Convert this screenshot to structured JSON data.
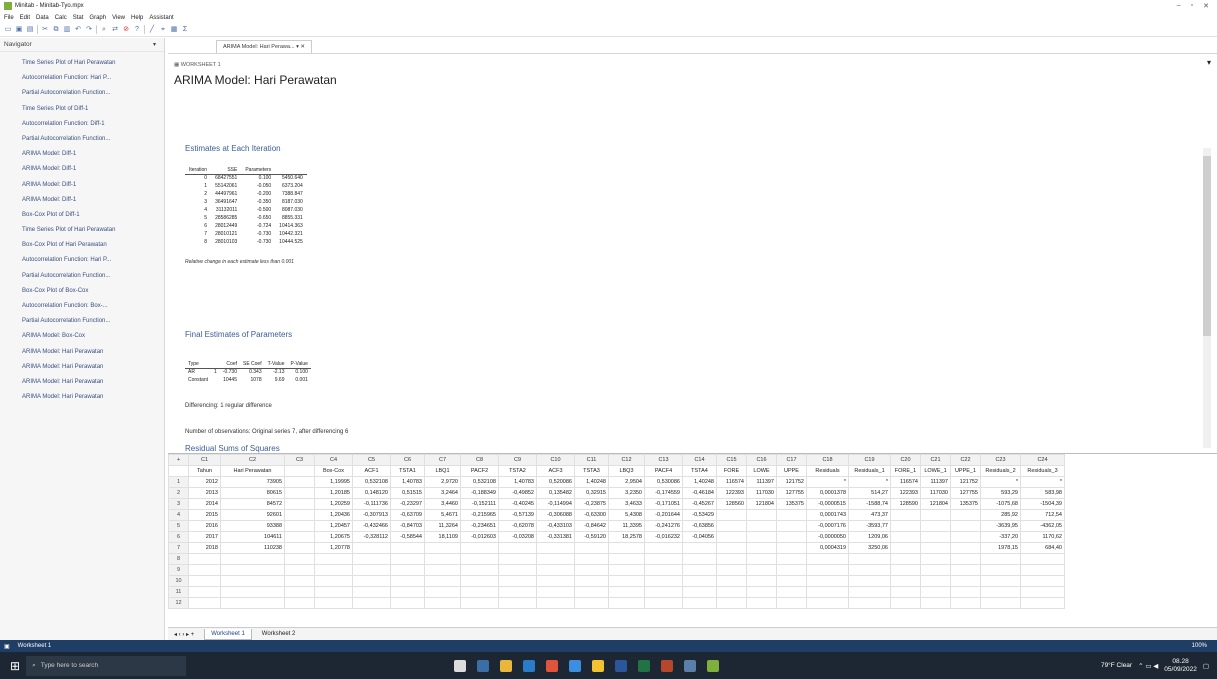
{
  "window": {
    "title": "Minitab - Minitab-Tyo.mpx"
  },
  "menu": [
    "File",
    "Edit",
    "Data",
    "Calc",
    "Stat",
    "Graph",
    "View",
    "Help",
    "Assistant"
  ],
  "navigator": {
    "title": "Navigator",
    "items": [
      "Time Series Plot of Hari Perawatan",
      "Autocorrelation Function: Hari P...",
      "Partial Autocorrelation Function...",
      "Time Series Plot of Diff-1",
      "Autocorrelation Function: Diff-1",
      "Partial Autocorrelation Function...",
      "ARIMA Model: Diff-1",
      "ARIMA Model: Diff-1",
      "ARIMA Model: Diff-1",
      "ARIMA Model: Diff-1",
      "Box-Cox Plot of Diff-1",
      "Time Series Plot of Hari Perawatan",
      "Box-Cox Plot of Hari Perawatan",
      "Autocorrelation Function: Hari P...",
      "Partial Autocorrelation Function...",
      "Box-Cox Plot of Box-Cox",
      "Autocorrelation Function: Box-...",
      "Partial Autocorrelation Function...",
      "ARIMA Model: Box-Cox",
      "ARIMA Model: Hari Perawatan",
      "ARIMA Model: Hari Perawatan",
      "ARIMA Model: Hari Perawatan",
      "ARIMA Model: Hari Perawatan"
    ]
  },
  "output": {
    "tab_label": "ARIMA Model: Hari Perawa...",
    "worksheet": "WORKSHEET 1",
    "title": "ARIMA Model: Hari Perawatan",
    "estimates_heading": "Estimates at Each Iteration",
    "iter_headers": [
      "Iteration",
      "SSE",
      "Parameters",
      ""
    ],
    "iterations": [
      [
        "0",
        "68427551",
        "0.100",
        "5450.640"
      ],
      [
        "1",
        "55142061",
        "-0.050",
        "6373.204"
      ],
      [
        "2",
        "44497961",
        "-0.200",
        "7388.847"
      ],
      [
        "3",
        "36491647",
        "-0.350",
        "8187.030"
      ],
      [
        "4",
        "31132011",
        "-0.500",
        "8087.030"
      ],
      [
        "5",
        "28586285",
        "-0.650",
        "8855.331"
      ],
      [
        "6",
        "28012449",
        "-0.724",
        "10414.363"
      ],
      [
        "7",
        "28010121",
        "-0.730",
        "10442.321"
      ],
      [
        "8",
        "28010103",
        "-0.730",
        "10444.525"
      ]
    ],
    "conv_note": "Relative change in each estimate less than 0.001",
    "final_heading": "Final Estimates of Parameters",
    "param_headers": [
      "Type",
      "",
      "Coef",
      "SE Coef",
      "T-Value",
      "P-Value"
    ],
    "params": [
      [
        "AR",
        "1",
        "-0.730",
        "0.343",
        "-2.13",
        "0.100"
      ],
      [
        "Constant",
        "",
        "10445",
        "1078",
        "9.69",
        "0.001"
      ]
    ],
    "differencing": "Differencing: 1 regular difference",
    "observations": "Number of observations:  Original series 7, after differencing 6",
    "rss_heading": "Residual Sums of Squares"
  },
  "sheet": {
    "cols": [
      "C1",
      "C2",
      "C3",
      "C4",
      "C5",
      "C6",
      "C7",
      "C8",
      "C9",
      "C10",
      "C11",
      "C12",
      "C13",
      "C14",
      "C15",
      "C16",
      "C17",
      "C18",
      "C19",
      "C20",
      "C21",
      "C22",
      "C23",
      "C24"
    ],
    "names": [
      "Tahun",
      "Hari Perawatan",
      "",
      "Box-Cox",
      "ACF1",
      "TSTA1",
      "LBQ1",
      "PACF2",
      "TSTA2",
      "ACF3",
      "TSTA3",
      "LBQ3",
      "PACF4",
      "TSTA4",
      "FORE",
      "LOWE",
      "UPPE",
      "Residuals",
      "Residuals_1",
      "FORE_1",
      "LOWE_1",
      "UPPE_1",
      "Residuals_2",
      "Residuals_3"
    ],
    "rows": [
      [
        "2012",
        "73905",
        "",
        "1,19995",
        "0,532108",
        "1,40783",
        "2,9720",
        "0,532108",
        "1,40783",
        "0,520086",
        "1,40248",
        "2,9504",
        "0,530086",
        "1,40248",
        "116574",
        "111397",
        "121752",
        "*",
        "*",
        "116574",
        "111397",
        "121752",
        "*",
        "*"
      ],
      [
        "2013",
        "80615",
        "",
        "1,20185",
        "0,148120",
        "0,51515",
        "3,2464",
        "-0,188349",
        "-0,49852",
        "0,135482",
        "0,32915",
        "3,2350",
        "-0,174559",
        "-0,46184",
        "122393",
        "117030",
        "127755",
        "0,0001378",
        "514,27",
        "122393",
        "117030",
        "127755",
        "593,29",
        "583,98"
      ],
      [
        "2014",
        "84572",
        "",
        "1,20259",
        "-0,111736",
        "-0,23297",
        "3,4460",
        "-0,152111",
        "-0,40245",
        "-0,114994",
        "-0,23875",
        "3,4633",
        "-0,171051",
        "-0,45267",
        "128560",
        "121804",
        "135375",
        "-0,0000515",
        "-1588,74",
        "128590",
        "121804",
        "135375",
        "-1075,68",
        "-1504,39"
      ],
      [
        "2015",
        "92601",
        "",
        "1,20436",
        "-0,307913",
        "-0,63709",
        "5,4671",
        "-0,215965",
        "-0,57139",
        "-0,306088",
        "-0,63300",
        "5,4308",
        "-0,201644",
        "-0,53429",
        "",
        "",
        "",
        "0,0001743",
        "473,37",
        "",
        "",
        "",
        "285,92",
        "712,54"
      ],
      [
        "2016",
        "93388",
        "",
        "1,20457",
        "-0,432466",
        "-0,84703",
        "11,3264",
        "-0,234651",
        "-0,62078",
        "-0,433103",
        "-0,84642",
        "11,3395",
        "-0,241276",
        "-0,63856",
        "",
        "",
        "",
        "-0,0007176",
        "-3593,77",
        "",
        "",
        "",
        "-3639,95",
        "-4362,05"
      ],
      [
        "2017",
        "104611",
        "",
        "1,20675",
        "-0,328112",
        "-0,58544",
        "18,1109",
        "-0,012603",
        "-0,03208",
        "-0,331381",
        "-0,59120",
        "18,2578",
        "-0,016232",
        "-0,04056",
        "",
        "",
        "",
        "-0,0000050",
        "1209,06",
        "",
        "",
        "",
        "-337,20",
        "1170,62"
      ],
      [
        "2018",
        "110238",
        "",
        "1,20778",
        "",
        "",
        "",
        "",
        "",
        "",
        "",
        "",
        "",
        "",
        "",
        "",
        "",
        "0,0004319",
        "3250,06",
        "",
        "",
        "",
        "1978,15",
        "684,40"
      ]
    ],
    "empty_rows": [
      "8",
      "9",
      "10",
      "11",
      "12"
    ],
    "tabs": [
      "Worksheet 1",
      "Worksheet 2"
    ]
  },
  "status": {
    "label": "Worksheet 1",
    "zoom": "100%"
  },
  "taskbar": {
    "search": "Type here to search",
    "weather": "79°F  Clear",
    "time": "08.28",
    "date": "05/09/2022"
  },
  "colors": {
    "accent": "#3b5e98",
    "status": "#1f3e66",
    "taskbar": "#1d2733"
  }
}
